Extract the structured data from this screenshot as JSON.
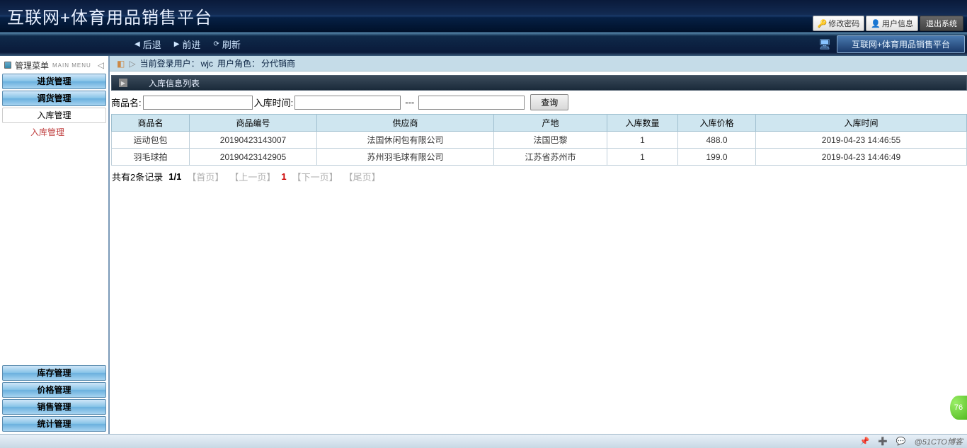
{
  "header": {
    "title": "互联网+体育用品销售平台",
    "change_pwd": "修改密码",
    "user_info": "用户信息",
    "exit": "退出系统"
  },
  "toolbar": {
    "back": "后退",
    "forward": "前进",
    "refresh": "刷新",
    "tab_label": "互联网+体育用品销售平台"
  },
  "sidebar": {
    "menu_title": "管理菜单",
    "menu_sub": "MAIN MENU",
    "top_items": [
      "进货管理",
      "调货管理",
      "入库管理"
    ],
    "active_sub": "入库管理",
    "bottom_items": [
      "库存管理",
      "价格管理",
      "销售管理",
      "统计管理"
    ]
  },
  "info_bar": {
    "prefix": "当前登录用户：",
    "user": "wjc",
    "role_prefix": "用户角色：",
    "role": "分代销商"
  },
  "section_header": "入库信息列表",
  "search": {
    "label_name": "商品名:",
    "label_time": "入库时间:",
    "separator": "---",
    "button": "查询",
    "value_name": "",
    "value_time_from": "",
    "value_time_to": ""
  },
  "table": {
    "columns": [
      "商品名",
      "商品编号",
      "供应商",
      "产地",
      "入库数量",
      "入库价格",
      "入库时间"
    ],
    "rows": [
      [
        "运动包包",
        "20190423143007",
        "法国休闲包有限公司",
        "法国巴黎",
        "1",
        "488.0",
        "2019-04-23 14:46:55"
      ],
      [
        "羽毛球拍",
        "20190423142905",
        "苏州羽毛球有限公司",
        "江苏省苏州市",
        "1",
        "199.0",
        "2019-04-23 14:46:49"
      ]
    ]
  },
  "pagination": {
    "summary": "共有2条记录",
    "pages": "1/1",
    "first": "【首页】",
    "prev": "【上一页】",
    "current": "1",
    "next": "【下一页】",
    "last": "【尾页】"
  },
  "footer": {
    "watermark": "@51CTO博客"
  },
  "badge": "76"
}
